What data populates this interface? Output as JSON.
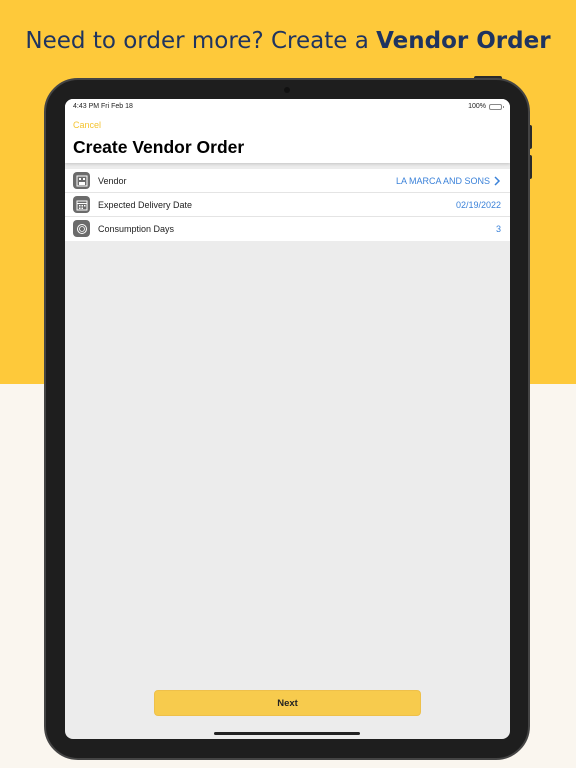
{
  "headline": {
    "prefix": "Need to order more? Create a ",
    "bold": "Vendor Order"
  },
  "status_bar": {
    "time": "4:43 PM   Fri Feb 18",
    "battery": "100%"
  },
  "nav": {
    "cancel_label": "Cancel",
    "title": "Create Vendor Order"
  },
  "rows": [
    {
      "label": "Vendor",
      "value": "LA MARCA AND SONS",
      "icon": "vendor-icon"
    },
    {
      "label": "Expected Delivery Date",
      "value": "02/19/2022",
      "icon": "calendar-icon"
    },
    {
      "label": "Consumption Days",
      "value": "3",
      "icon": "consumption-icon"
    }
  ],
  "next_label": "Next",
  "colors": {
    "background_top": "#fec93a",
    "background_bottom": "#faf6ef",
    "headline": "#1f3460",
    "accent": "#f4c430",
    "link_value": "#3b82d9",
    "button": "#f7cb4d"
  }
}
